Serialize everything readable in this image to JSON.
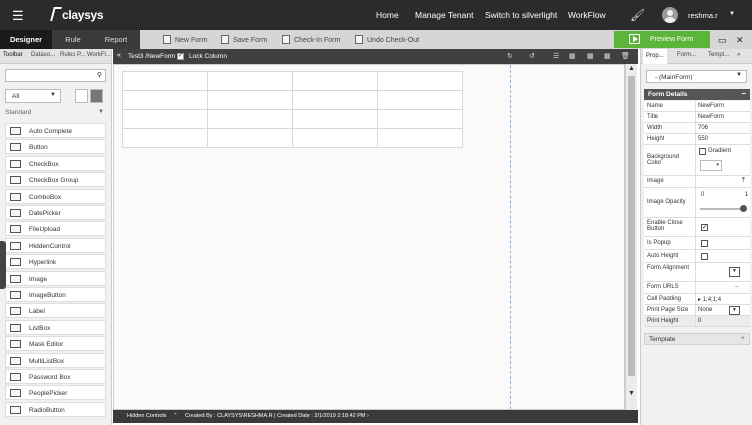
{
  "topbar": {
    "logo": "claysys",
    "nav": [
      "Home",
      "Manage Tenant",
      "Switch to silverlight",
      "WorkFlow"
    ],
    "user": "reshma.r"
  },
  "toolbar": {
    "tabs": [
      "Designer",
      "Rule",
      "Report"
    ],
    "buttons": [
      "New Form",
      "Save Form",
      "Check-In Form",
      "Undo Check-Out"
    ],
    "preview": "Preview Form"
  },
  "left_panel": {
    "tabs": [
      "Toolbar",
      "Dataso...",
      "Rules P...",
      "WorkFl..."
    ],
    "filter_value": "All",
    "section": "Standard",
    "controls": [
      "Auto Complete",
      "Button",
      "CheckBox",
      "CheckBox Group",
      "ComboBox",
      "DatePicker",
      "FileUpload",
      "HiddenControl",
      "Hyperlink",
      "Image",
      "ImageButton",
      "Label",
      "ListBox",
      "Mask Editor",
      "MultiListBox",
      "Password Box",
      "PeoplePicker",
      "RadioButton"
    ]
  },
  "canvas": {
    "path": "Test3 /NewForm",
    "lock_label": "Lock Column",
    "grid_rows": 4,
    "grid_cols": 4
  },
  "status": {
    "hidden": "Hidden Controls",
    "created": "Created By : CLAYSYS\\RESHMA.R | Created Date : 2/1/2019 2:18:42 PM"
  },
  "right_panel": {
    "tabs": [
      "Prop...",
      "Form...",
      "Templ..."
    ],
    "main_select": "- (MainForm)",
    "section": "Form Details",
    "props": {
      "name_k": "Name",
      "name_v": "NewForm",
      "title_k": "Title",
      "title_v": "NewForm",
      "width_k": "Width",
      "width_v": "706",
      "height_k": "Height",
      "height_v": "550",
      "bg_k": "Background Color",
      "gradient": "Gradient",
      "image_k": "Image",
      "opacity_k": "Image Opacity",
      "opacity_min": "0",
      "opacity_max": "1",
      "close_k": "Enable Close Button",
      "popup_k": "Is Popup",
      "autoh_k": "Auto Height",
      "align_k": "Form Alignment",
      "urls_k": "Form URLS",
      "urls_btn": "...",
      "pad_k": "Cell Padding",
      "pad_v": "1;4;1;4",
      "pps_k": "Print Page Size",
      "pps_v": "None",
      "ph_k": "Print Height",
      "ph_v": "0"
    },
    "template": "Template"
  }
}
